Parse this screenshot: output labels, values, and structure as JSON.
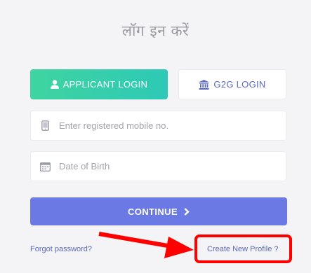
{
  "title": "लॉग इन करें",
  "tabs": {
    "applicant_label": "APPLICANT LOGIN",
    "g2g_label": "G2G LOGIN"
  },
  "fields": {
    "mobile_placeholder": "Enter registered mobile no.",
    "dob_placeholder": "Date of Birth"
  },
  "continue_label": "CONTINUE",
  "links": {
    "forgot_password": "Forgot password?",
    "create_profile": "Create New Profile ?"
  },
  "colors": {
    "applicant_gradient": [
      "#3fd4a0",
      "#2ec9b6"
    ],
    "continue_bg": "#6b79e4",
    "highlight": "#ff0000",
    "link": "#5a6ab8"
  },
  "icons": {
    "applicant": "user-icon",
    "g2g": "bank-icon",
    "mobile": "mobile-phone-icon",
    "dob": "calendar-icon",
    "continue": "chevron-right-icon"
  }
}
